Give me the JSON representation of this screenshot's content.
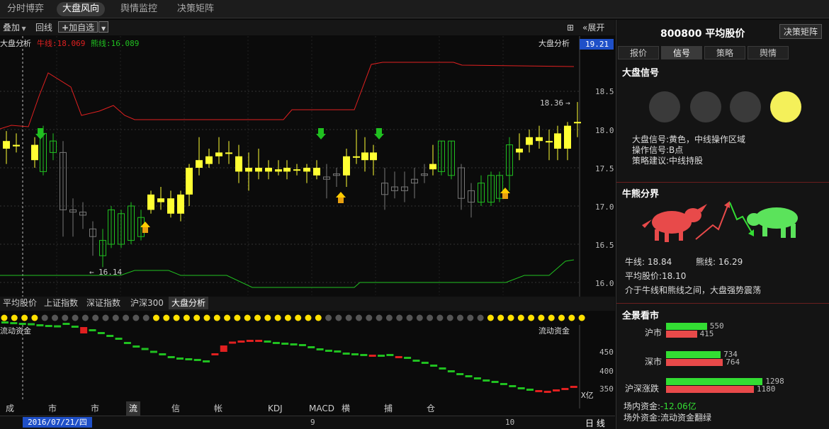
{
  "top_tabs": [
    "分时博弈",
    "大盘风向",
    "舆情监控",
    "决策矩阵"
  ],
  "top_active": 1,
  "toolbar": {
    "overlay": "叠加",
    "return": "回线",
    "add_fav": "加自选",
    "expand": "展开"
  },
  "chart": {
    "legend_left": "大盘分析",
    "bull_label": "牛线:18.069",
    "bear_label": "熊线:16.089",
    "legend_right": "大盘分析",
    "current_price": "19.21",
    "y_ticks": [
      "18.5",
      "18.0",
      "17.5",
      "17.0",
      "16.5",
      "16.0"
    ],
    "high_mark": "18.36",
    "low_mark": "16.14",
    "flow_title_left": "流动资金",
    "flow_title_right": "流动资金",
    "flow_ticks": [
      "450",
      "400",
      "350"
    ],
    "flow_unit": "X亿",
    "colors": {
      "bull_line": "#e02020",
      "bear_line": "#20c020",
      "up_candle": "#ffff33",
      "down_candle": "#20c020",
      "flow_up": "#e02020",
      "flow_down": "#20c020"
    }
  },
  "index_tabs": [
    "平均股价",
    "上证指数",
    "深证指数",
    "沪深300",
    "大盘分析"
  ],
  "index_active": 4,
  "bottom_tabs": [
    "成交量",
    "市盈率",
    "市净率",
    "流动资金",
    "信心指数",
    "帐户跟踪",
    "KDJ",
    "MACD",
    "横向指标",
    "捕捞季节",
    "仓位策略"
  ],
  "bottom_active": 3,
  "date_bar": {
    "date": "2016/07/21/四",
    "mark1": "9",
    "mark2": "10",
    "period": "日 线"
  },
  "right_panel": {
    "code_title": "800800 平均股价",
    "decision_button": "决策矩阵",
    "tabs": [
      "报价",
      "信号",
      "策略",
      "舆情"
    ],
    "tab_active": 1,
    "signal": {
      "title": "大盘信号",
      "lights_active": 3,
      "lines": [
        "大盘信号:黄色，中线操作区域",
        "操作信号:B点",
        "策略建议:中线持股"
      ]
    },
    "bull_bear": {
      "title": "牛熊分界",
      "bull": "牛线: 18.84",
      "bear": "熊线: 16.29",
      "avg": "平均股价:18.10",
      "desc": "介于牛线和熊线之间，大盘强势震荡"
    },
    "panorama": {
      "title": "全景看市",
      "rows": [
        {
          "label": "沪市",
          "green": 550,
          "red": 415
        },
        {
          "label": "深市",
          "green": 734,
          "red": 764
        },
        {
          "label": "沪深涨跌",
          "green": 1298,
          "red": 1180
        }
      ],
      "inflow_label": "场内资金:",
      "inflow_value": "-12.06亿",
      "outflow": "场外资金:流动资金翻绿"
    }
  }
}
